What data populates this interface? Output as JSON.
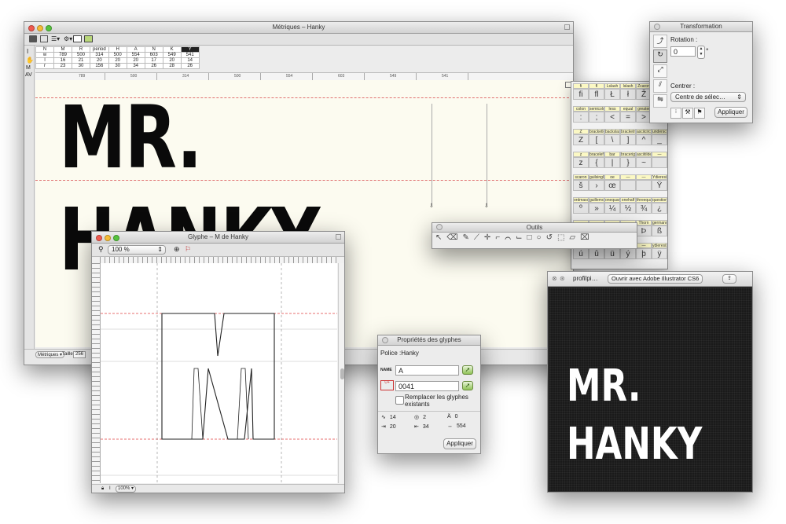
{
  "metrics_window": {
    "title": "Métriques – Hanky",
    "table": {
      "header": [
        "M",
        "R",
        "period",
        "H",
        "A",
        "N",
        "K",
        "Y"
      ],
      "rows": [
        {
          "label": "w",
          "cells": [
            "789",
            "500",
            "314",
            "500",
            "554",
            "603",
            "549",
            "541"
          ]
        },
        {
          "label": "l",
          "cells": [
            "16",
            "21",
            "20",
            "20",
            "20",
            "17",
            "20",
            "14"
          ]
        },
        {
          "label": "r",
          "cells": [
            "23",
            "30",
            "156",
            "30",
            "34",
            "26",
            "28",
            "26"
          ]
        }
      ]
    },
    "ruler_values": [
      "789",
      "500",
      "314",
      "500",
      "554",
      "603",
      "549",
      "541"
    ],
    "preview_text": "MR. HANKY",
    "status_dropdown": "Métriques",
    "size_label": "Taille :",
    "size_value": "256"
  },
  "charmap": {
    "headers": [
      [
        "fi",
        "fl",
        "Lslash",
        "lslash",
        "Zcaron"
      ],
      [
        "colon",
        "semicolon",
        "less",
        "equal",
        "greater",
        "question"
      ],
      [
        "Z",
        "bracketleft",
        "backslash",
        "bracketright",
        "asciicircum",
        "underscore"
      ],
      [
        "z",
        "braceleft",
        "bar",
        "braceright",
        "asciitilde",
        "—"
      ],
      [
        "scaron",
        "guilsinglright",
        "oe",
        "—",
        "—",
        "Ydieresis"
      ],
      [
        "ordmasculine",
        "guillemotright",
        "onequarter",
        "onehalf",
        "threequarters",
        "questiondown"
      ],
      [
        "—",
        "—",
        "—",
        "—",
        "Thorn",
        "germandbls"
      ],
      [
        "—",
        "—",
        "—",
        "—",
        "—",
        "ydieresis"
      ]
    ],
    "rows": [
      [
        "ﬁ",
        "ﬂ",
        "Ł",
        "ł",
        "Ž"
      ],
      [
        ":",
        ";",
        "<",
        "=",
        ">",
        "?"
      ],
      [
        "Z",
        "[",
        "\\",
        "]",
        "^",
        "_"
      ],
      [
        "z",
        "{",
        "|",
        "}",
        "~",
        ""
      ],
      [
        "š",
        "›",
        "œ",
        "",
        "",
        "Ÿ"
      ],
      [
        "º",
        "»",
        "¼",
        "½",
        "¾",
        "¿"
      ],
      [
        "",
        "",
        "",
        "",
        "Þ",
        "ß"
      ],
      [
        "ú",
        "û",
        "ü",
        "ý",
        "þ",
        "ÿ"
      ]
    ]
  },
  "glyph_window": {
    "title": "Glyphe – M de Hanky",
    "zoom_value": "100 %",
    "bottom_zoom": "100%"
  },
  "transformation": {
    "title": "Transformation",
    "rotation_label": "Rotation :",
    "rotation_value": "0",
    "degree_symbol": "°",
    "center_label": "Centrer :",
    "center_value": "Centre de sélec…",
    "apply_label": "Appliquer"
  },
  "outils": {
    "title": "Outils"
  },
  "properties": {
    "title": "Propriétés des glyphes",
    "font_line": "Police :Hanky",
    "name_icon_label": "NAME",
    "name_value": "A",
    "unicode_value": "0041",
    "replace_label": "Remplacer les glyphes existants",
    "stats": [
      {
        "icon": "∿",
        "value": "14"
      },
      {
        "icon": "◎",
        "value": "2"
      },
      {
        "icon": "Ä",
        "value": "0"
      },
      {
        "icon": "⇥",
        "value": "20"
      },
      {
        "icon": "⇤",
        "value": "34"
      },
      {
        "icon": "↔",
        "value": "554"
      }
    ],
    "apply_label": "Appliquer"
  },
  "preview_window": {
    "title": "profilpi…",
    "open_button": "Ouvrir avec Adobe Illustrator CS6",
    "line1": "MR.",
    "line2": "HANKY"
  }
}
